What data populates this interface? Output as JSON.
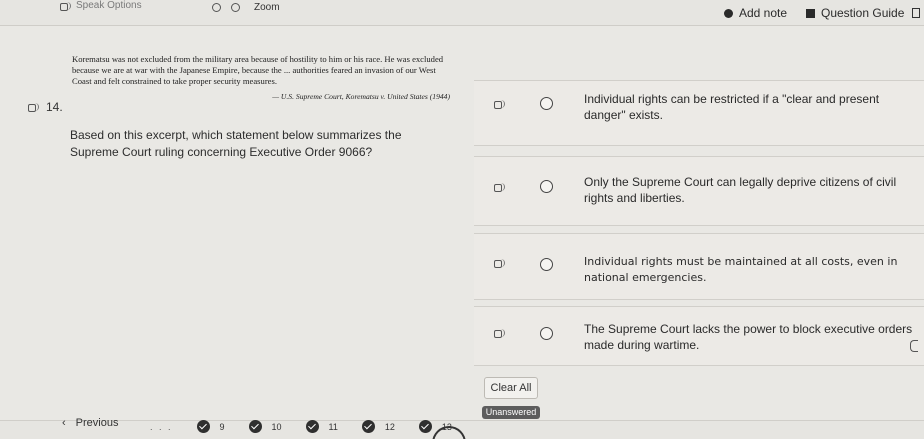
{
  "toolbar": {
    "speak_options": "Speak Options",
    "zoom": "Zoom",
    "add_note": "Add note",
    "question_guide": "Question Guide"
  },
  "question": {
    "number": "14.",
    "excerpt": "Korematsu was not excluded from the military area because of hostility to him or his race. He was excluded because we are at war with the Japanese Empire, because the ... authorities feared an invasion of our West Coast and felt constrained to take proper security measures.",
    "citation": "— U.S. Supreme Court, Korematsu v. United States (1944)",
    "prompt": "Based on this excerpt, which statement below summarizes the Supreme Court ruling concerning Executive Order 9066?"
  },
  "choices": [
    {
      "text": "Individual rights can be restricted if a \"clear and present danger\" exists."
    },
    {
      "text": "Only the Supreme Court can legally deprive citizens of civil rights and liberties."
    },
    {
      "text": "Individual rights must be maintained at all costs, even in national emergencies."
    },
    {
      "text": "The Supreme Court lacks the power to block executive orders made during wartime."
    }
  ],
  "clear_all": "Clear All",
  "status_badge": "Unanswered",
  "nav": {
    "previous": "Previous",
    "ellipsis": ". . .",
    "pages": [
      "9",
      "10",
      "11",
      "12",
      "13"
    ]
  }
}
